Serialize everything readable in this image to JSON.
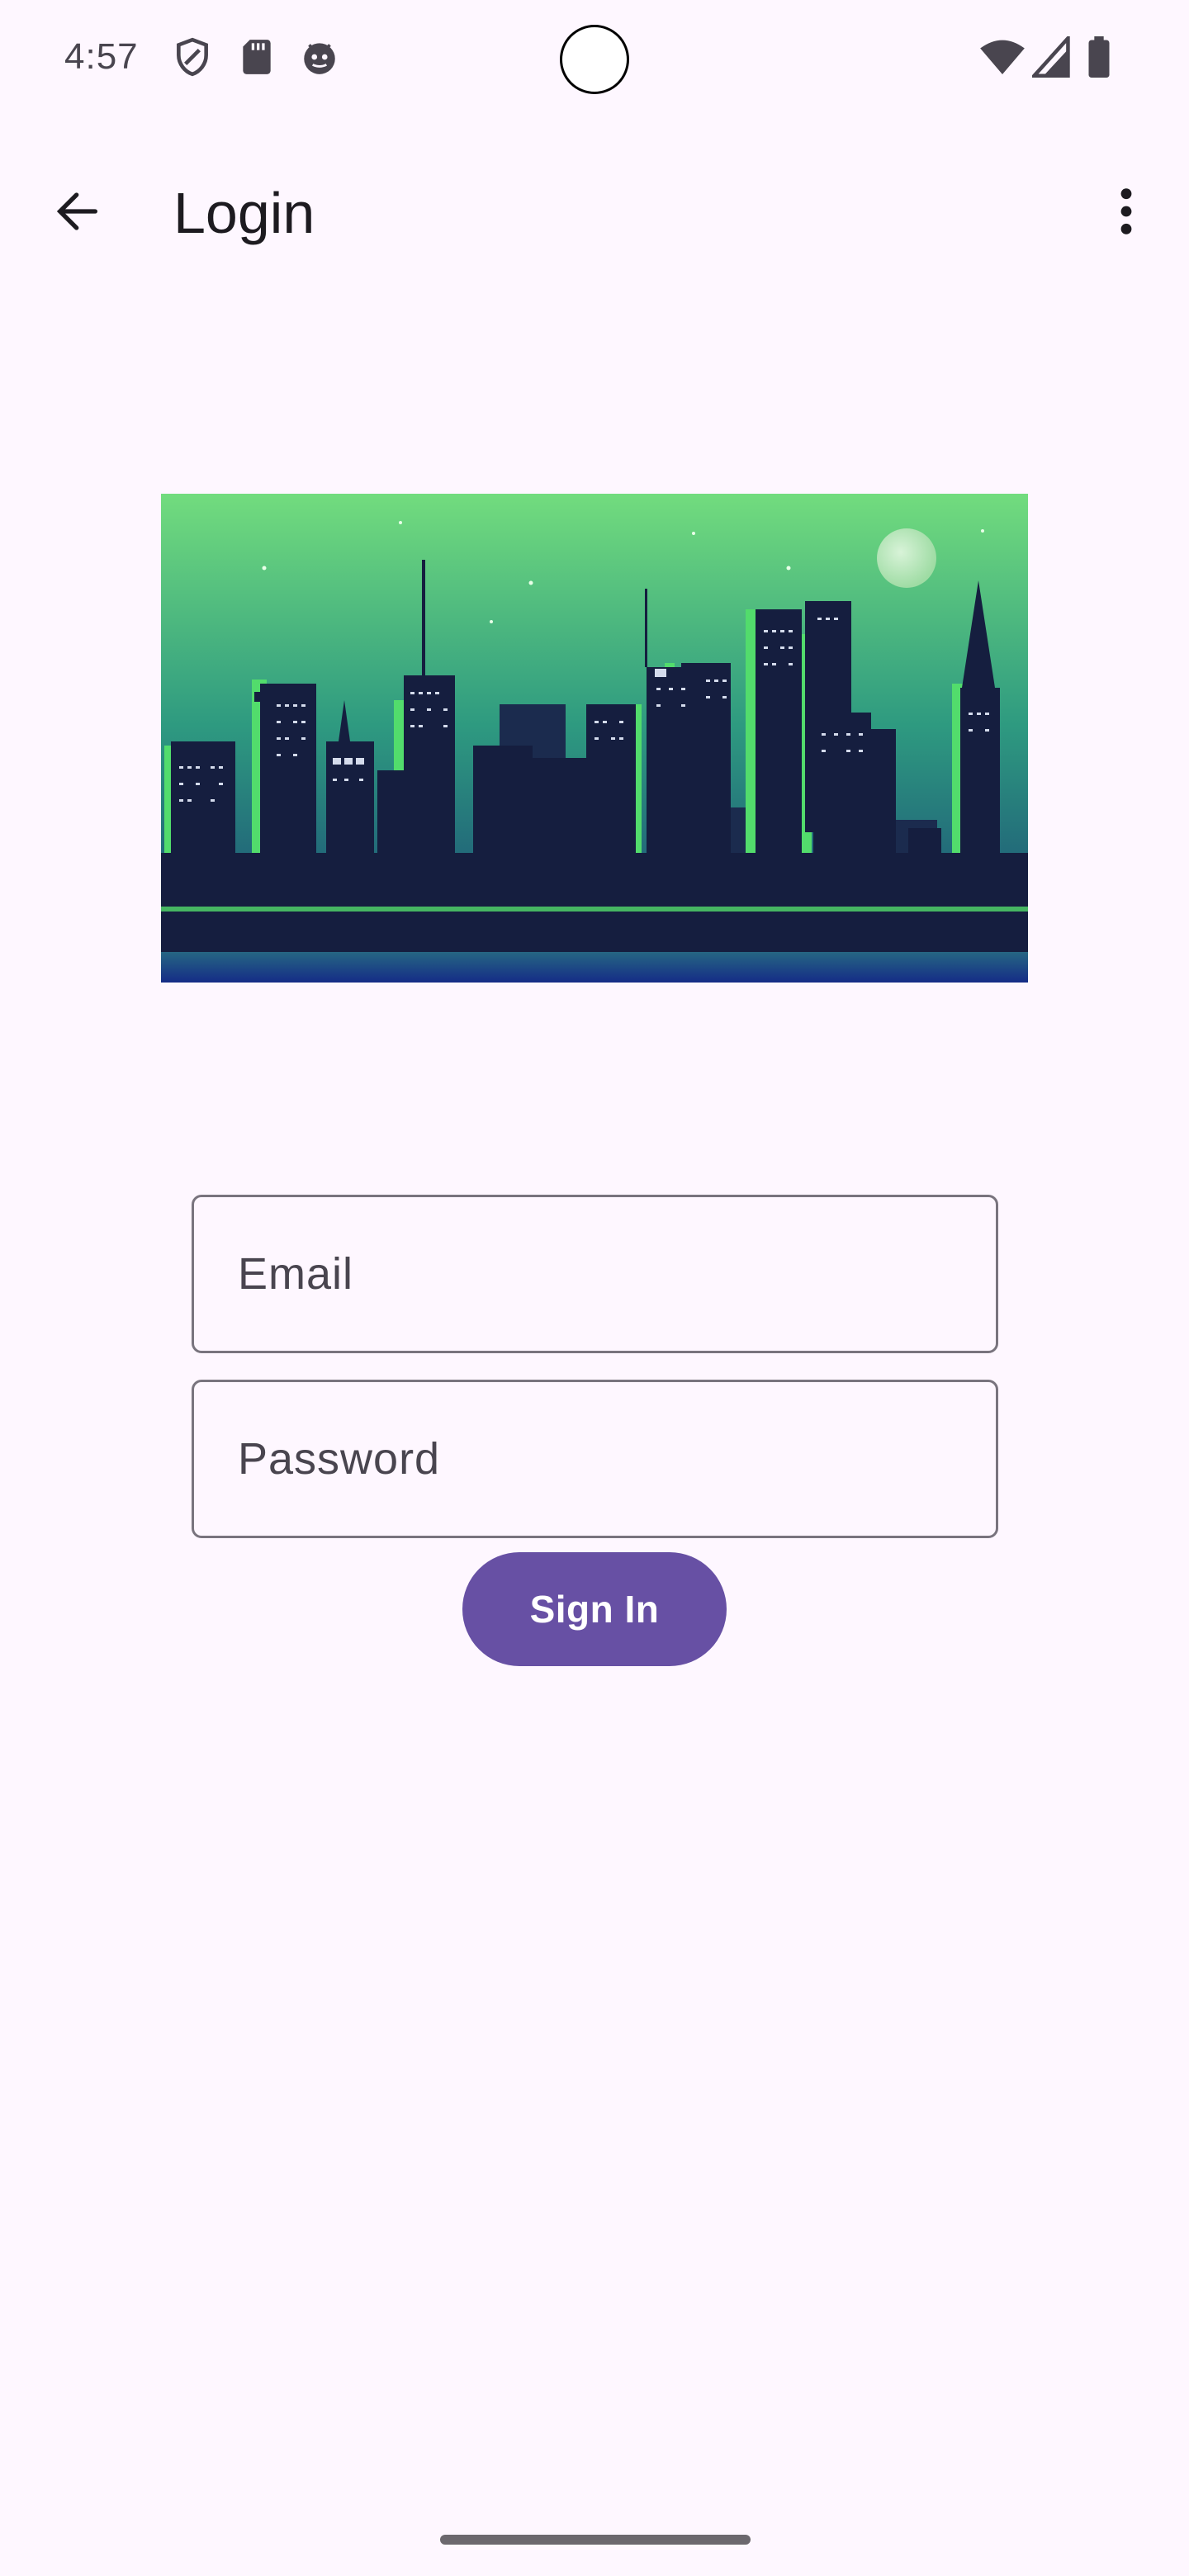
{
  "status_bar": {
    "time": "4:57",
    "left_icons": [
      "shield-icon",
      "sd-card-icon",
      "android-debug-icon"
    ],
    "right_icons": [
      "wifi-icon",
      "signal-icon",
      "battery-icon"
    ]
  },
  "app_bar": {
    "title": "Login",
    "back_icon": "arrow-back-icon",
    "menu_icon": "more-vert-icon"
  },
  "hero": {
    "icon": "city-skyline-illustration"
  },
  "form": {
    "email_placeholder": "Email",
    "email_value": "",
    "password_placeholder": "Password",
    "password_value": "",
    "sign_in_label": "Sign In"
  },
  "colors": {
    "background": "#FEF7FF",
    "primary": "#6750A4",
    "outline": "#79747E",
    "on_surface": "#1D1B20",
    "sky_top": "#6FDB7C",
    "sky_bottom": "#1D5E78",
    "building_dark": "#151E3F",
    "building_accent": "#4FE06A"
  }
}
